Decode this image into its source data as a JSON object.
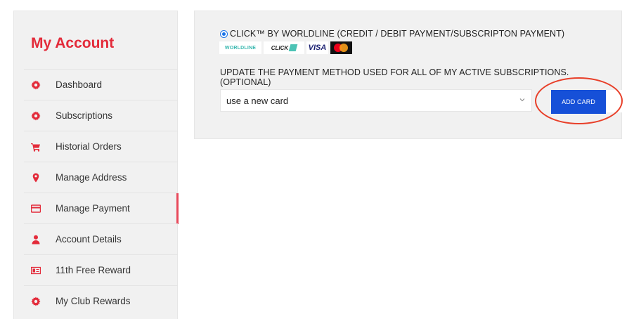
{
  "sidebar": {
    "title": "My Account",
    "items": [
      {
        "label": "Dashboard",
        "icon": "gear-icon"
      },
      {
        "label": "Subscriptions",
        "icon": "gear-icon"
      },
      {
        "label": "Historial Orders",
        "icon": "cart-icon"
      },
      {
        "label": "Manage Address",
        "icon": "map-pin-icon"
      },
      {
        "label": "Manage Payment",
        "icon": "credit-card-icon",
        "active": true
      },
      {
        "label": "Account Details",
        "icon": "user-icon"
      },
      {
        "label": "11th Free Reward",
        "icon": "ticket-icon"
      },
      {
        "label": "My Club Rewards",
        "icon": "gear-icon"
      }
    ]
  },
  "payment": {
    "method_label": "CLICK™ BY WORLDLINE (CREDIT / DEBIT PAYMENT/SUBSCRIPTON PAYMENT)",
    "logos": {
      "worldline": "WORLDLINE",
      "click": "CLICK",
      "visa": "VISA"
    },
    "update_text": "UPDATE THE PAYMENT METHOD USED FOR ALL OF MY ACTIVE SUBSCRIPTIONS. (OPTIONAL)",
    "card_select_value": "use a new card",
    "add_card_label": "ADD CARD"
  },
  "colors": {
    "accent_red": "#e32b3a",
    "button_blue": "#1650d8",
    "highlight": "#e8402a"
  }
}
